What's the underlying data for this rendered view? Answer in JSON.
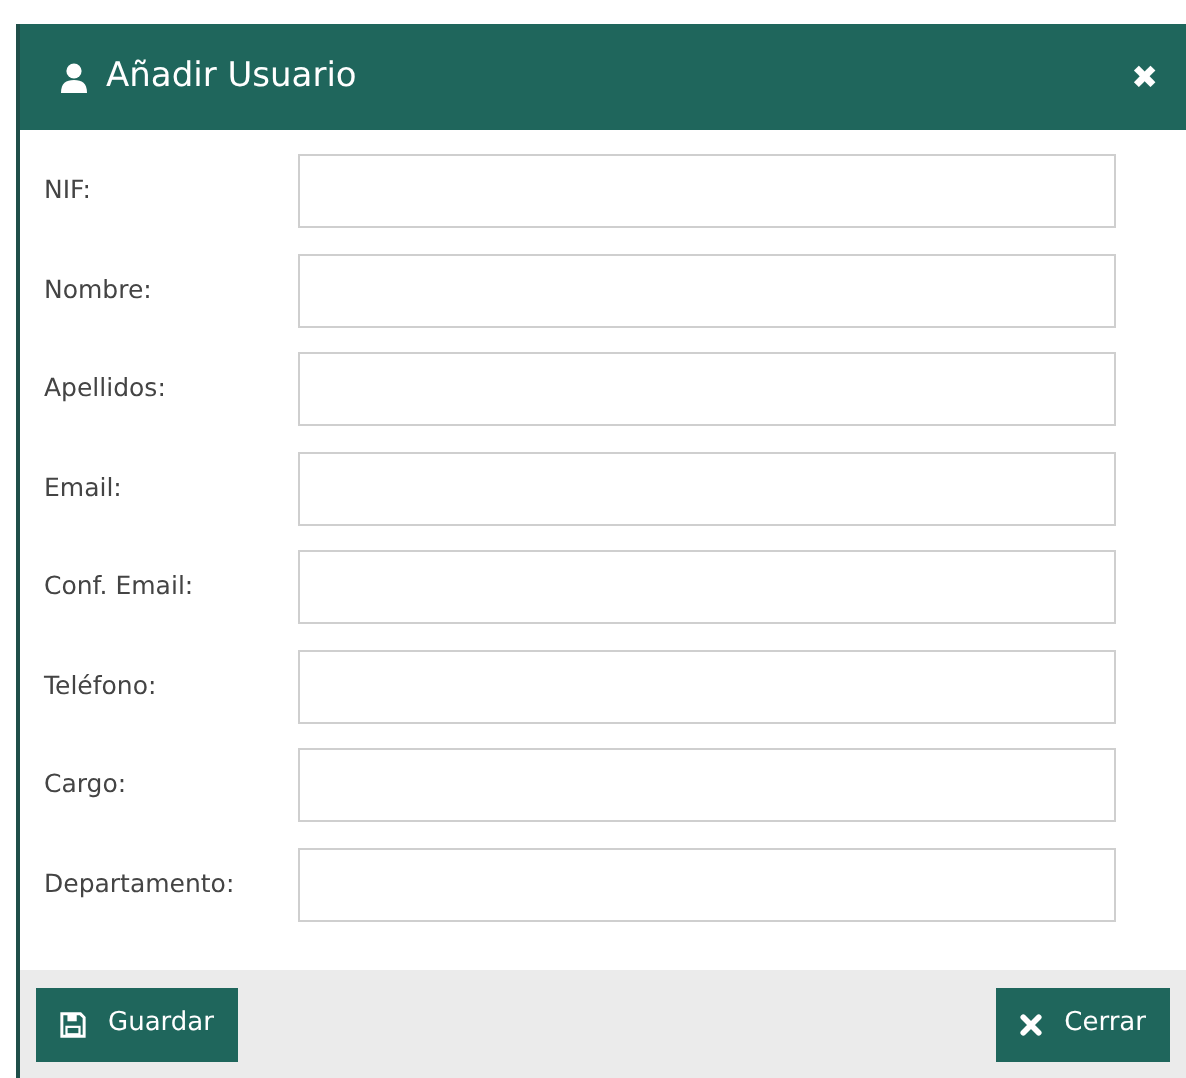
{
  "dialog": {
    "title": "Añadir Usuario",
    "close": "✖"
  },
  "fields": [
    {
      "label": "NIF:"
    },
    {
      "label": "Nombre:"
    },
    {
      "label": "Apellidos:"
    },
    {
      "label": "Email:"
    },
    {
      "label": "Conf. Email:"
    },
    {
      "label": "Teléfono:"
    },
    {
      "label": "Cargo:"
    },
    {
      "label": "Departamento:"
    }
  ],
  "buttons": [
    {
      "kind": "save",
      "label": "Guardar"
    },
    {
      "kind": "close",
      "label": "Cerrar"
    }
  ]
}
